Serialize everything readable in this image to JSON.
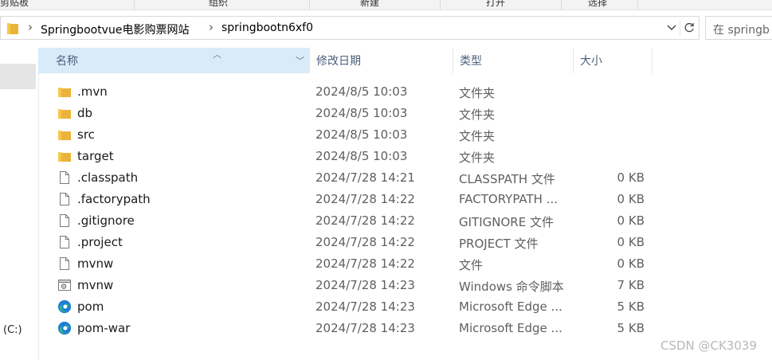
{
  "ribbon": {
    "groups": [
      "剪贴板",
      "组织",
      "新建",
      "打开",
      "选择"
    ]
  },
  "address": {
    "crumbs": [
      "Springbootvue电影购票网站",
      "springbootn6xf0"
    ],
    "dropdown_icon": "chevron-down-icon",
    "refresh_icon": "refresh-icon"
  },
  "search": {
    "placeholder": "在 springb"
  },
  "nav": {
    "drive_label": "(C:)"
  },
  "columns": {
    "name": "名称",
    "date": "修改日期",
    "type": "类型",
    "size": "大小"
  },
  "files": [
    {
      "name": ".mvn",
      "date": "2024/8/5 10:03",
      "type": "文件夹",
      "size": "",
      "icon": "folder-icon"
    },
    {
      "name": "db",
      "date": "2024/8/5 10:03",
      "type": "文件夹",
      "size": "",
      "icon": "folder-icon"
    },
    {
      "name": "src",
      "date": "2024/8/5 10:03",
      "type": "文件夹",
      "size": "",
      "icon": "folder-icon"
    },
    {
      "name": "target",
      "date": "2024/8/5 10:03",
      "type": "文件夹",
      "size": "",
      "icon": "folder-icon"
    },
    {
      "name": ".classpath",
      "date": "2024/7/28 14:21",
      "type": "CLASSPATH 文件",
      "size": "0 KB",
      "icon": "file-icon"
    },
    {
      "name": ".factorypath",
      "date": "2024/7/28 14:22",
      "type": "FACTORYPATH ...",
      "size": "0 KB",
      "icon": "file-icon"
    },
    {
      "name": ".gitignore",
      "date": "2024/7/28 14:22",
      "type": "GITIGNORE 文件",
      "size": "0 KB",
      "icon": "file-icon"
    },
    {
      "name": ".project",
      "date": "2024/7/28 14:22",
      "type": "PROJECT 文件",
      "size": "0 KB",
      "icon": "file-icon"
    },
    {
      "name": "mvnw",
      "date": "2024/7/28 14:22",
      "type": "文件",
      "size": "0 KB",
      "icon": "file-icon"
    },
    {
      "name": "mvnw",
      "date": "2024/7/28 14:23",
      "type": "Windows 命令脚本",
      "size": "7 KB",
      "icon": "script-icon"
    },
    {
      "name": "pom",
      "date": "2024/7/28 14:23",
      "type": "Microsoft Edge ...",
      "size": "5 KB",
      "icon": "edge-icon"
    },
    {
      "name": "pom-war",
      "date": "2024/7/28 14:23",
      "type": "Microsoft Edge ...",
      "size": "5 KB",
      "icon": "edge-icon"
    }
  ],
  "watermark": "CSDN @CK3039",
  "colors": {
    "folder": "#f8c74a",
    "header_sorted": "#d9ebf9",
    "edge_blue": "#1c7fd6",
    "edge_green": "#39c06e"
  }
}
